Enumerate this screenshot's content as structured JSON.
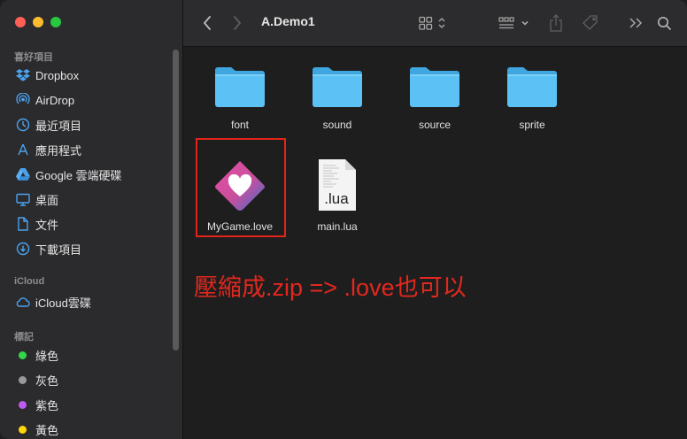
{
  "toolbar": {
    "title": "A.Demo1"
  },
  "sidebar": {
    "sections": [
      {
        "title": "喜好項目"
      },
      {
        "title": "iCloud"
      },
      {
        "title": "標記"
      }
    ],
    "favorites": [
      {
        "label": "Dropbox",
        "icon": "dropbox-icon"
      },
      {
        "label": "AirDrop",
        "icon": "airdrop-icon"
      },
      {
        "label": "最近項目",
        "icon": "clock-icon"
      },
      {
        "label": "應用程式",
        "icon": "applications-icon"
      },
      {
        "label": "Google 雲端硬碟",
        "icon": "google-drive-icon"
      },
      {
        "label": "桌面",
        "icon": "desktop-icon"
      },
      {
        "label": "文件",
        "icon": "document-icon"
      },
      {
        "label": "下載項目",
        "icon": "download-icon"
      }
    ],
    "icloud": [
      {
        "label": "iCloud雲碟",
        "icon": "cloud-icon"
      }
    ],
    "tags": [
      {
        "label": "綠色",
        "color": "#32d74b"
      },
      {
        "label": "灰色",
        "color": "#98989d"
      },
      {
        "label": "紫色",
        "color": "#bf5af2"
      },
      {
        "label": "黃色",
        "color": "#ffd60a"
      }
    ]
  },
  "files": [
    {
      "name": "font",
      "type": "folder"
    },
    {
      "name": "sound",
      "type": "folder"
    },
    {
      "name": "source",
      "type": "folder"
    },
    {
      "name": "sprite",
      "type": "folder"
    },
    {
      "name": "MyGame.love",
      "type": "love"
    },
    {
      "name": "main.lua",
      "type": "lua",
      "badge": ".lua"
    }
  ],
  "annotation": {
    "text": "壓縮成.zip => .love也可以",
    "color": "#e2241b"
  }
}
